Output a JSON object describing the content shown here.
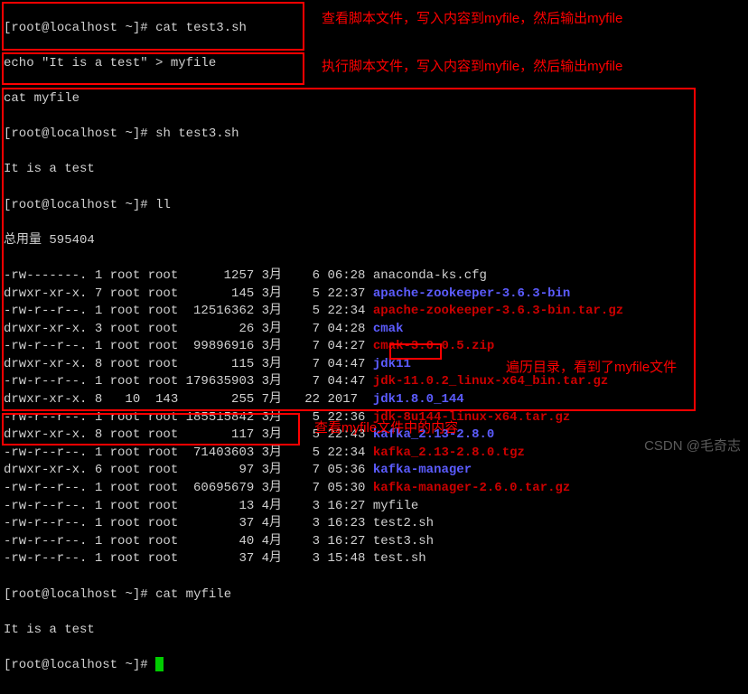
{
  "prompt": {
    "user": "root",
    "host": "localhost",
    "path": "~",
    "symbol": "#"
  },
  "cmd1": "cat test3.sh",
  "script": {
    "l1": "echo \"It is a test\" > myfile",
    "l2": "cat myfile"
  },
  "cmd2": "sh test3.sh",
  "out1": "It is a test",
  "cmd3": "ll",
  "total": "总用量 595404",
  "cmd4": "cat myfile",
  "out2": "It is a test",
  "rows": [
    {
      "perm": "-rw-------.",
      "ln": "1",
      "u": "root",
      "g": "root",
      "sz": "     1257",
      "m": "3月",
      "d": " 6",
      "t": "06:28",
      "name": "anaconda-ks.cfg",
      "cls": "white"
    },
    {
      "perm": "drwxr-xr-x.",
      "ln": "7",
      "u": "root",
      "g": "root",
      "sz": "      145",
      "m": "3月",
      "d": " 5",
      "t": "22:37",
      "name": "apache-zookeeper-3.6.3-bin",
      "cls": "blue"
    },
    {
      "perm": "-rw-r--r--.",
      "ln": "1",
      "u": "root",
      "g": "root",
      "sz": " 12516362",
      "m": "3月",
      "d": " 5",
      "t": "22:34",
      "name": "apache-zookeeper-3.6.3-bin.tar.gz",
      "cls": "red"
    },
    {
      "perm": "drwxr-xr-x.",
      "ln": "3",
      "u": "root",
      "g": "root",
      "sz": "       26",
      "m": "3月",
      "d": " 7",
      "t": "04:28",
      "name": "cmak",
      "cls": "blue"
    },
    {
      "perm": "-rw-r--r--.",
      "ln": "1",
      "u": "root",
      "g": "root",
      "sz": " 99896916",
      "m": "3月",
      "d": " 7",
      "t": "04:27",
      "name": "cmak-3.0.0.5.zip",
      "cls": "red"
    },
    {
      "perm": "drwxr-xr-x.",
      "ln": "8",
      "u": "root",
      "g": "root",
      "sz": "      115",
      "m": "3月",
      "d": " 7",
      "t": "04:47",
      "name": "jdk11",
      "cls": "blue"
    },
    {
      "perm": "-rw-r--r--.",
      "ln": "1",
      "u": "root",
      "g": "root",
      "sz": "179635903",
      "m": "3月",
      "d": " 7",
      "t": "04:47",
      "name": "jdk-11.0.2_linux-x64_bin.tar.gz",
      "cls": "red"
    },
    {
      "perm": "drwxr-xr-x.",
      "ln": "8",
      "u": "  10",
      "g": " 143",
      "sz": "      255",
      "m": "7月",
      "d": "22",
      "t": "2017 ",
      "name": "jdk1.8.0_144",
      "cls": "blue"
    },
    {
      "perm": "-rw-r--r--.",
      "ln": "1",
      "u": "root",
      "g": "root",
      "sz": "185515842",
      "m": "3月",
      "d": " 5",
      "t": "22:36",
      "name": "jdk-8u144-linux-x64.tar.gz",
      "cls": "red"
    },
    {
      "perm": "drwxr-xr-x.",
      "ln": "8",
      "u": "root",
      "g": "root",
      "sz": "      117",
      "m": "3月",
      "d": " 5",
      "t": "22:43",
      "name": "kafka_2.13-2.8.0",
      "cls": "blue"
    },
    {
      "perm": "-rw-r--r--.",
      "ln": "1",
      "u": "root",
      "g": "root",
      "sz": " 71403603",
      "m": "3月",
      "d": " 5",
      "t": "22:34",
      "name": "kafka_2.13-2.8.0.tgz",
      "cls": "red"
    },
    {
      "perm": "drwxr-xr-x.",
      "ln": "6",
      "u": "root",
      "g": "root",
      "sz": "       97",
      "m": "3月",
      "d": " 7",
      "t": "05:36",
      "name": "kafka-manager",
      "cls": "blue"
    },
    {
      "perm": "-rw-r--r--.",
      "ln": "1",
      "u": "root",
      "g": "root",
      "sz": " 60695679",
      "m": "3月",
      "d": " 7",
      "t": "05:30",
      "name": "kafka-manager-2.6.0.tar.gz",
      "cls": "red"
    },
    {
      "perm": "-rw-r--r--.",
      "ln": "1",
      "u": "root",
      "g": "root",
      "sz": "       13",
      "m": "4月",
      "d": " 3",
      "t": "16:27",
      "name": "myfile",
      "cls": "white"
    },
    {
      "perm": "-rw-r--r--.",
      "ln": "1",
      "u": "root",
      "g": "root",
      "sz": "       37",
      "m": "4月",
      "d": " 3",
      "t": "16:23",
      "name": "test2.sh",
      "cls": "white"
    },
    {
      "perm": "-rw-r--r--.",
      "ln": "1",
      "u": "root",
      "g": "root",
      "sz": "       40",
      "m": "4月",
      "d": " 3",
      "t": "16:27",
      "name": "test3.sh",
      "cls": "white"
    },
    {
      "perm": "-rw-r--r--.",
      "ln": "1",
      "u": "root",
      "g": "root",
      "sz": "       37",
      "m": "4月",
      "d": " 3",
      "t": "15:48",
      "name": "test.sh",
      "cls": "white"
    }
  ],
  "anno1": "查看脚本文件，写入内容到myfile，然后输出myfile",
  "anno2": "执行脚本文件，写入内容到myfile，然后输出myfile",
  "anno3": "遍历目录，看到了myfile文件",
  "anno4": "查看myfile文件中的内容",
  "watermark": "CSDN @毛奇志"
}
